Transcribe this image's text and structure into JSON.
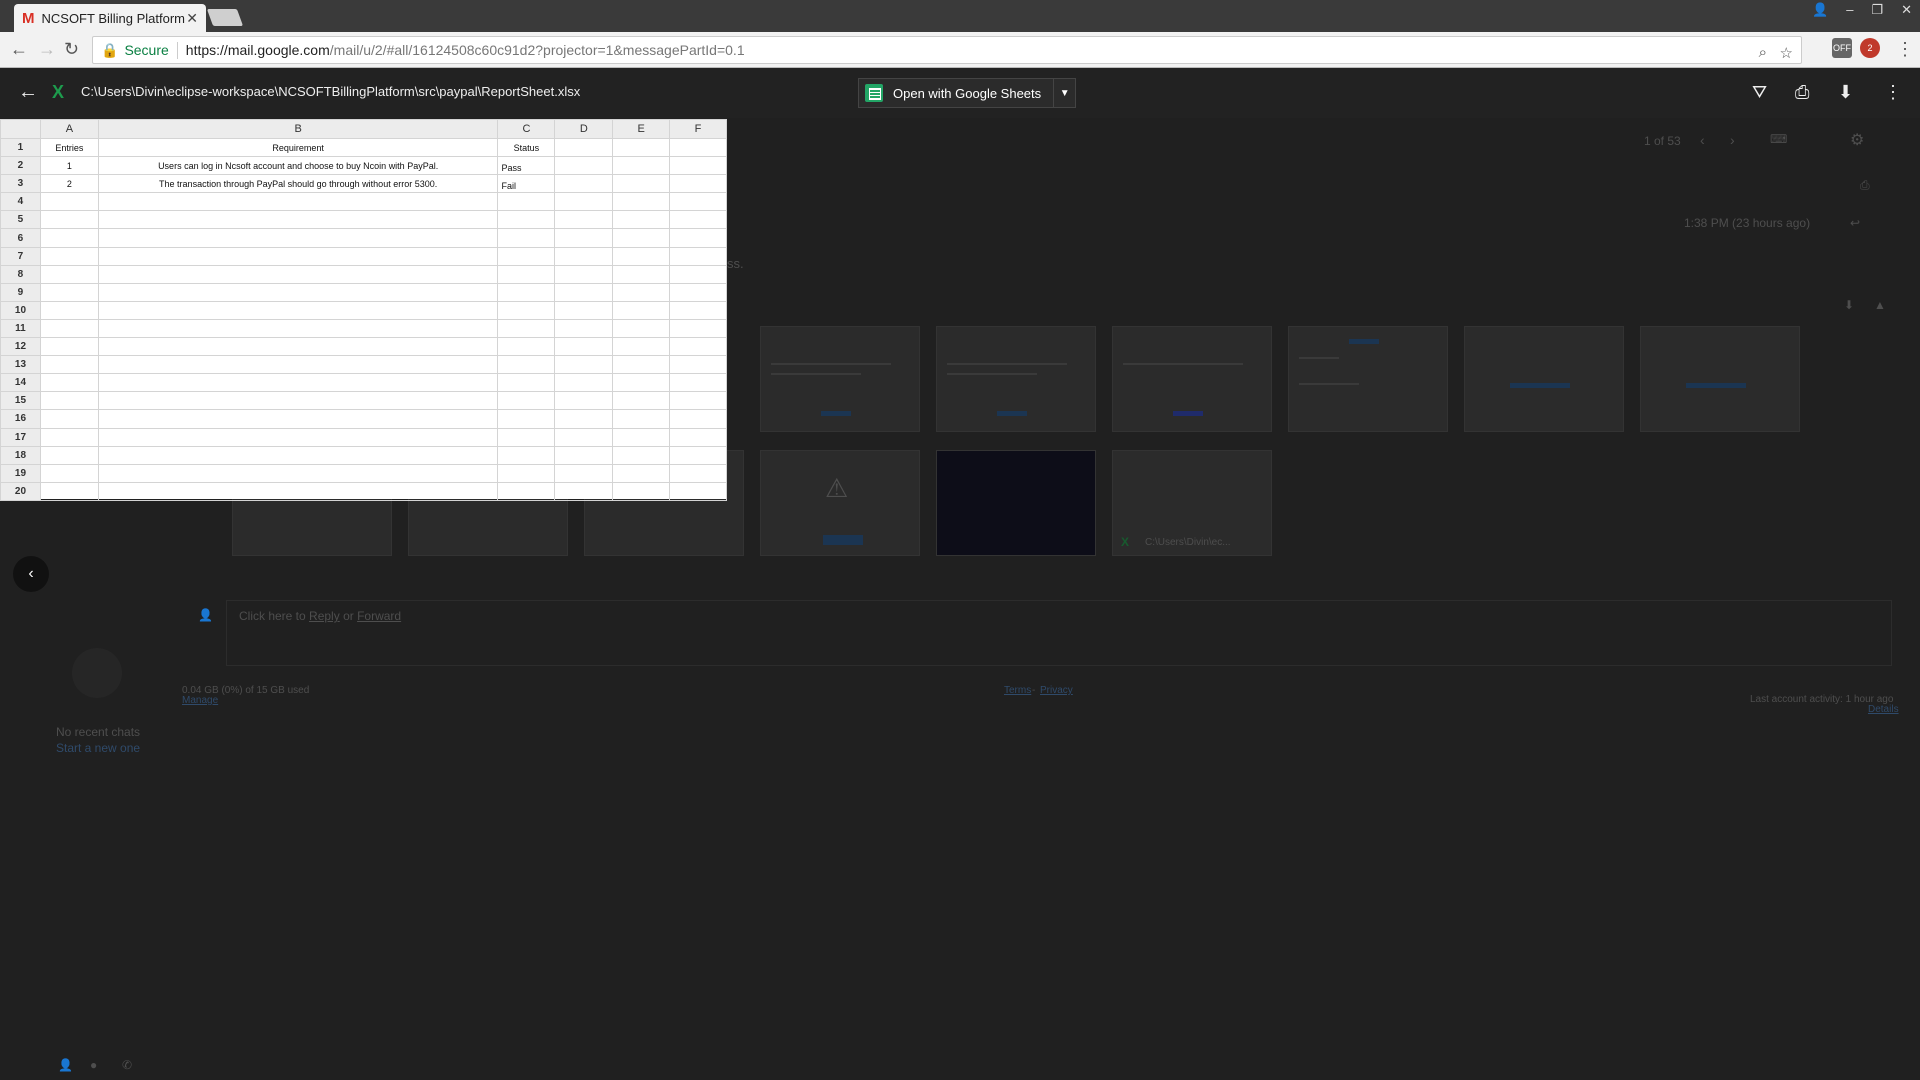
{
  "browser": {
    "tab_title": "NCSOFT Billing Platform",
    "secure_label": "Secure",
    "url_host": "https://mail.google.com",
    "url_path": "/mail/u/2/#all/16124508c60c91d2?projector=1&messagePartId=0.1",
    "ext_off_badge": "OFF",
    "ext_count_badge": "2"
  },
  "viewer": {
    "file_path": "C:\\Users\\Divin\\eclipse-workspace\\NCSOFTBillingPlatform\\src\\paypal\\ReportSheet.xlsx",
    "open_with_label": "Open with Google Sheets"
  },
  "sheet": {
    "columns": [
      "A",
      "B",
      "C",
      "D",
      "E",
      "F"
    ],
    "row_numbers": [
      "1",
      "2",
      "3",
      "4",
      "5",
      "6",
      "7",
      "8",
      "9",
      "10",
      "11",
      "12",
      "13",
      "14",
      "15",
      "16",
      "17",
      "18",
      "19",
      "20"
    ],
    "header": {
      "a": "Entries",
      "b": "Requirement",
      "c": "Status"
    },
    "rows": [
      {
        "a": "1",
        "b": "Users can log in Ncsoft account and choose to buy Ncoin with PayPal.",
        "c": "Pass"
      },
      {
        "a": "2",
        "b": "The transaction through PayPal should go through without error 5300.",
        "c": "Fail"
      }
    ]
  },
  "gmail_bg": {
    "pager": "1 of 53",
    "timestamp": "1:38 PM (23 hours ago)",
    "snippet_end": "ss.",
    "reply_prefix": "Click here to",
    "reply_link": "Reply",
    "reply_or": "or",
    "forward_link": "Forward",
    "storage": "0.04 GB (0%) of 15 GB used",
    "manage": "Manage",
    "terms": "Terms",
    "sep": "-",
    "privacy": "Privacy",
    "last_activity": "Last account activity: 1 hour ago",
    "details": "Details",
    "no_chats": "No recent chats",
    "start_new": "Start a new one",
    "attachment_name": "C:\\Users\\Divin\\ec..."
  },
  "colors": {
    "accent_green": "#1d9b4d",
    "sheets_green": "#23a566",
    "gmail_red": "#d93025"
  }
}
